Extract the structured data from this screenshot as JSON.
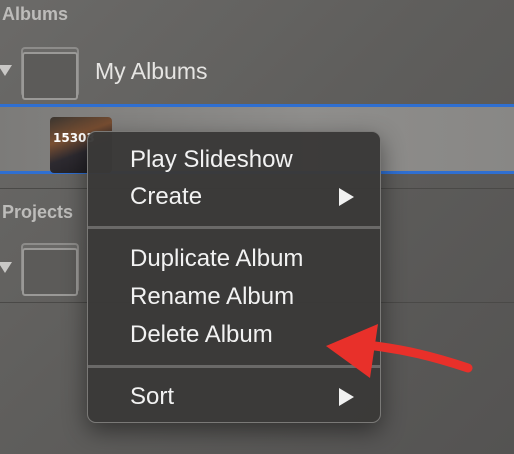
{
  "sidebar": {
    "albums_header": "Albums",
    "my_albums_label": "My Albums",
    "projects_header": "Projects",
    "selected_album_thumbnail_text": "15303"
  },
  "context_menu": {
    "play_slideshow": "Play Slideshow",
    "create": "Create",
    "duplicate_album": "Duplicate Album",
    "rename_album": "Rename Album",
    "delete_album": "Delete Album",
    "sort": "Sort"
  },
  "annotation": {
    "arrow_color": "#e8302a",
    "points_to": "delete-album-menu-item"
  },
  "colors": {
    "selection_border": "#2f6fd1",
    "menu_background": "#3a3938",
    "menu_text": "#f2f2f2"
  },
  "icons": {
    "disclosure": "disclosure-triangle-down-icon",
    "folder": "album-folder-icon",
    "submenu": "submenu-chevron-right-icon"
  }
}
